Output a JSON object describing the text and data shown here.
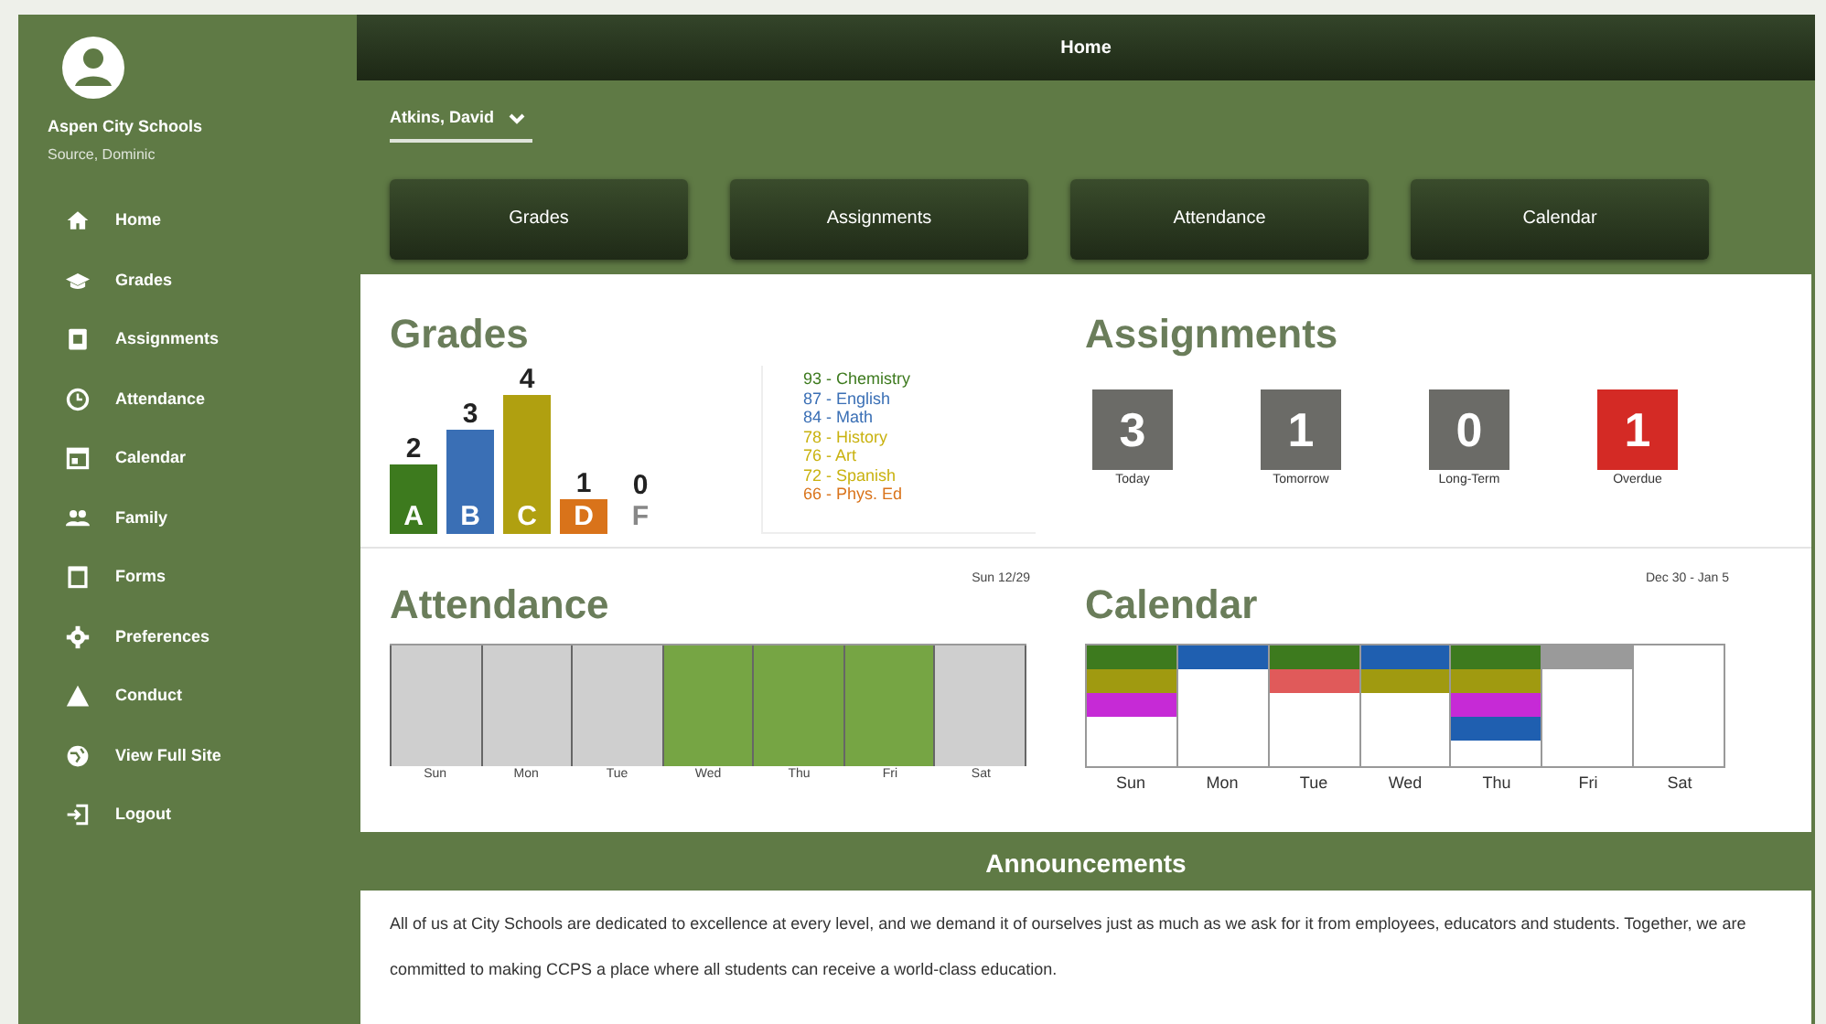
{
  "sidebar": {
    "school": "Aspen City Schools",
    "user": "Source, Dominic",
    "items": [
      "Home",
      "Grades",
      "Assignments",
      "Attendance",
      "Calendar",
      "Family",
      "Forms",
      "Preferences",
      "Conduct",
      "View Full Site",
      "Logout"
    ]
  },
  "header": {
    "title": "Home"
  },
  "student_select": {
    "value": "Atkins, David"
  },
  "nav_buttons": [
    "Grades",
    "Assignments",
    "Attendance",
    "Calendar"
  ],
  "grades": {
    "title": "Grades",
    "bars": [
      {
        "letter": "A",
        "count": "2",
        "color": "#3d7a1e"
      },
      {
        "letter": "B",
        "count": "3",
        "color": "#3a6fb5"
      },
      {
        "letter": "C",
        "count": "4",
        "color": "#b0a010"
      },
      {
        "letter": "D",
        "count": "1",
        "color": "#d9731a"
      },
      {
        "letter": "F",
        "count": "0",
        "color": "#888888"
      }
    ],
    "courses": [
      {
        "text": "93 - Chemistry",
        "color": "#3d7a1e"
      },
      {
        "text": "87 - English",
        "color": "#3a6fb5"
      },
      {
        "text": "84 - Math",
        "color": "#3a6fb5"
      },
      {
        "text": "78 - History",
        "color": "#c9b20f"
      },
      {
        "text": "76 - Art",
        "color": "#c9b20f"
      },
      {
        "text": "72 - Spanish",
        "color": "#c9b20f"
      },
      {
        "text": "66 - Phys. Ed",
        "color": "#d9731a"
      }
    ]
  },
  "assignments": {
    "title": "Assignments",
    "tiles": [
      {
        "count": "3",
        "label": "Today",
        "color": "#6b6b67"
      },
      {
        "count": "1",
        "label": "Tomorrow",
        "color": "#6b6b67"
      },
      {
        "count": "0",
        "label": "Long-Term",
        "color": "#6b6b67"
      },
      {
        "count": "1",
        "label": "Overdue",
        "color": "#d42a25"
      }
    ]
  },
  "attendance": {
    "title": "Attendance",
    "date": "Sun 12/29",
    "days": [
      {
        "label": "Sun",
        "present": false
      },
      {
        "label": "Mon",
        "present": false
      },
      {
        "label": "Tue",
        "present": false
      },
      {
        "label": "Wed",
        "present": true
      },
      {
        "label": "Thu",
        "present": true
      },
      {
        "label": "Fri",
        "present": true
      },
      {
        "label": "Sat",
        "present": false
      }
    ]
  },
  "calendar": {
    "title": "Calendar",
    "range": "Dec 30 - Jan 5",
    "days": [
      {
        "label": "Sun",
        "events": [
          {
            "color": "#3d7a1e"
          },
          {
            "color": "#a09a10"
          },
          {
            "color": "#c62ad6"
          }
        ]
      },
      {
        "label": "Mon",
        "events": [
          {
            "color": "#1f5fb0"
          }
        ]
      },
      {
        "label": "Tue",
        "events": [
          {
            "color": "#3d7a1e"
          },
          {
            "color": "#e05a5a"
          }
        ]
      },
      {
        "label": "Wed",
        "events": [
          {
            "color": "#1f5fb0"
          },
          {
            "color": "#a09a10"
          }
        ]
      },
      {
        "label": "Thu",
        "events": [
          {
            "color": "#3d7a1e"
          },
          {
            "color": "#a09a10"
          },
          {
            "color": "#c62ad6"
          },
          {
            "color": "#1f5fb0"
          }
        ]
      },
      {
        "label": "Fri",
        "events": [
          {
            "color": "#9a9a9a"
          }
        ]
      },
      {
        "label": "Sat"
      }
    ]
  },
  "announcements": {
    "title": "Announcements",
    "text": "All of us at City Schools are dedicated to excellence at every level, and we demand it of ourselves just as much as we ask for it from employees, educators and students. Together, we are committed to making CCPS a place where all students can receive a world-class education."
  }
}
